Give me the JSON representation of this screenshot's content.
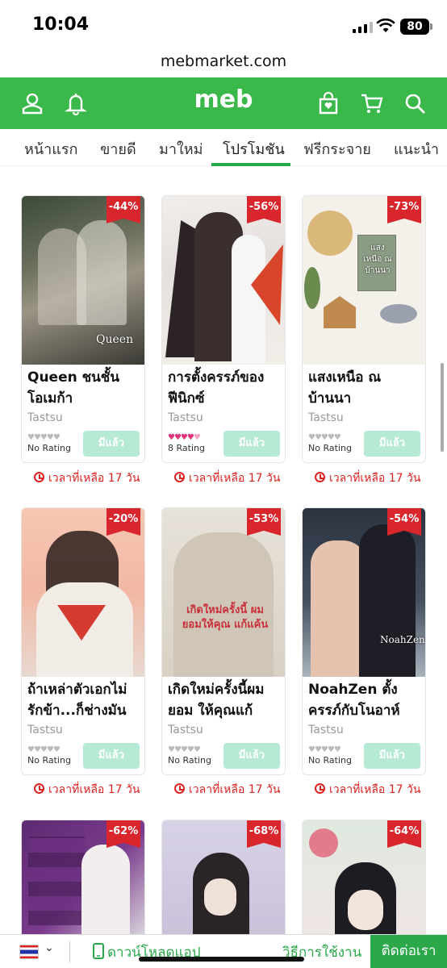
{
  "status_bar": {
    "time": "10:04",
    "battery": "80"
  },
  "browser": {
    "url": "mebmarket.com"
  },
  "header": {
    "logo": "meb"
  },
  "tabs": [
    {
      "label": "หน้าแรก"
    },
    {
      "label": "ขายดี"
    },
    {
      "label": "มาใหม่"
    },
    {
      "label": "โปรโมชัน",
      "active": true
    },
    {
      "label": "ฟรีกระจาย"
    },
    {
      "label": "แนะนำ"
    }
  ],
  "peek_row": {
    "label": "เวลาที่เหลือ 17 วัน"
  },
  "books": [
    {
      "cover_text": "Queen",
      "title": "Queen ชนชั้น\nโอเมก้า",
      "author": "Tastsu",
      "discount": "-44%",
      "rating": "No Rating",
      "rating_hearts": 0,
      "button": "มีแล้ว",
      "time_left": "เวลาที่เหลือ 17 วัน"
    },
    {
      "cover_text": "",
      "title": "การตั้งครรภ์ของ\nฟีนิกซ์",
      "author": "Tastsu",
      "discount": "-56%",
      "rating": "8 Rating",
      "rating_hearts": 4.5,
      "button": "มีแล้ว",
      "time_left": "เวลาที่เหลือ 17 วัน"
    },
    {
      "cover_text": "แสงเหนือ ณ บ้านนา",
      "title": "แสงเหนือ ณ\nบ้านนา",
      "author": "Tastsu",
      "discount": "-73%",
      "rating": "No Rating",
      "rating_hearts": 0,
      "button": "มีแล้ว",
      "time_left": "เวลาที่เหลือ 17 วัน"
    },
    {
      "cover_text": "",
      "title": "ถ้าเหล่าตัวเอกไม่\nรักข้า...ก็ช่างมัน",
      "author": "Tastsu",
      "discount": "-20%",
      "rating": "No Rating",
      "rating_hearts": 0,
      "button": "มีแล้ว",
      "time_left": "เวลาที่เหลือ 17 วัน"
    },
    {
      "cover_text": "เกิดใหม่ครั้งนี้ ผมยอมให้คุณ แก้แค้น",
      "title": "เกิดใหม่ครั้งนี้ผม\nยอม ให้คุณแก้",
      "author": "Tastsu",
      "discount": "-53%",
      "rating": "No Rating",
      "rating_hearts": 0,
      "button": "มีแล้ว",
      "time_left": "เวลาที่เหลือ 17 วัน"
    },
    {
      "cover_text": "NoahZen",
      "title": "NoahZen ตั้ง\nครรภ์กับโนอาห์",
      "author": "Tastsu",
      "discount": "-54%",
      "rating": "No Rating",
      "rating_hearts": 0,
      "button": "มีแล้ว",
      "time_left": "เวลาที่เหลือ 17 วัน"
    },
    {
      "cover_text": "",
      "title": "",
      "author": "",
      "discount": "-62%",
      "rating": "",
      "button": "",
      "time_left": ""
    },
    {
      "cover_text": "",
      "title": "",
      "author": "",
      "discount": "-68%",
      "rating": "",
      "button": "",
      "time_left": ""
    },
    {
      "cover_text": "",
      "title": "",
      "author": "",
      "discount": "-64%",
      "rating": "",
      "button": "",
      "time_left": ""
    }
  ],
  "bottom_bar": {
    "download": "ดาวน์โหลดแอป",
    "how_to": "วิธีการใช้งาน",
    "contact": "ติดต่อเรา"
  },
  "colors": {
    "brand_green": "#3ab84a",
    "discount_red": "#d9262c",
    "owned_button": "#b6ead4"
  }
}
